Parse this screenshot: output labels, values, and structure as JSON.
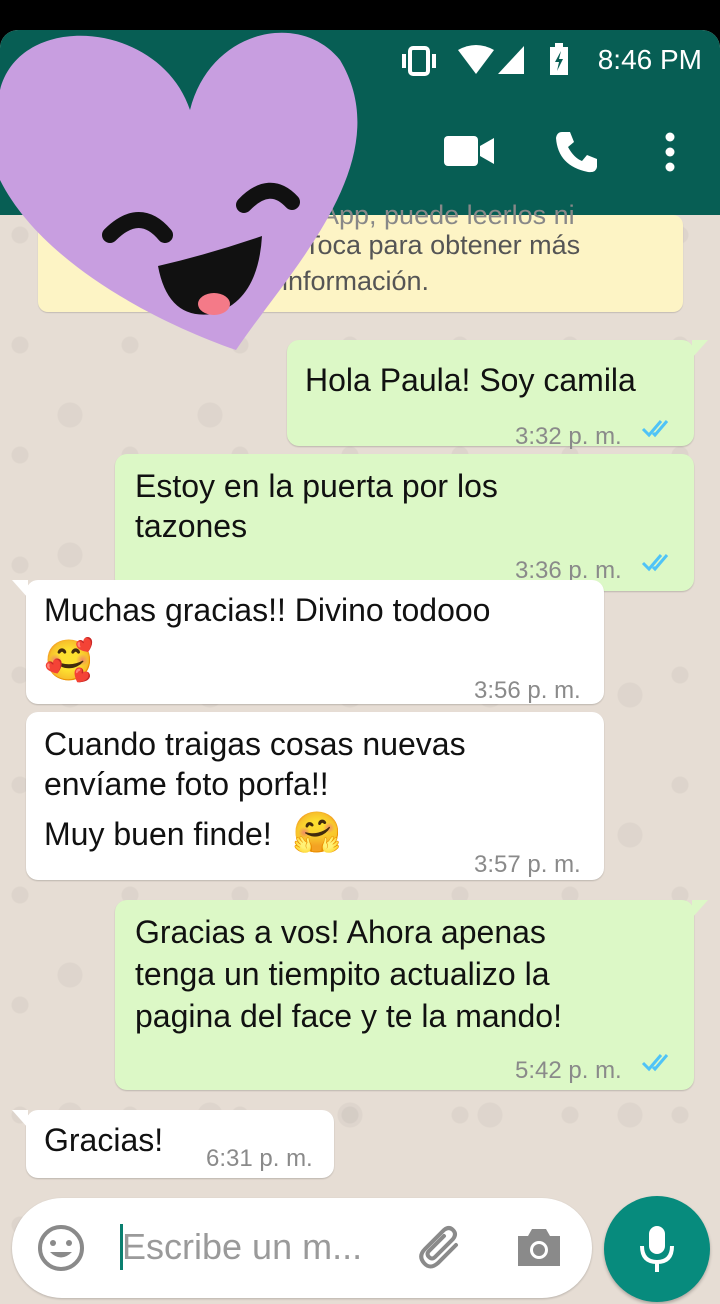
{
  "status": {
    "time": "8:46 PM"
  },
  "notice": {
    "line1": "tsApp, puede leerlos ni",
    "line2": "Toca para obtener más",
    "line3": "información."
  },
  "messages": [
    {
      "dir": "out",
      "text": "Hola Paula! Soy camila",
      "time": "3:32 p. m.",
      "read": true
    },
    {
      "dir": "out",
      "lines": [
        "Estoy en la puerta por los",
        "tazones"
      ],
      "time": "3:36 p. m.",
      "read": true
    },
    {
      "dir": "in",
      "text": "Muchas gracias!! Divino todooo",
      "emoji": "🥰",
      "time": "3:56 p. m."
    },
    {
      "dir": "in",
      "lines": [
        "Cuando traigas cosas nuevas",
        "envíame foto porfa!!",
        "Muy buen finde!"
      ],
      "emoji": "🤗",
      "time": "3:57 p. m."
    },
    {
      "dir": "out",
      "lines": [
        "Gracias a vos! Ahora apenas",
        "tenga un tiempito actualizo la",
        "pagina del face y te la mando!"
      ],
      "time": "5:42 p. m.",
      "read": true
    },
    {
      "dir": "in",
      "text": "Gracias!",
      "time": "6:31 p. m."
    }
  ],
  "composer": {
    "placeholder": "Escribe un m..."
  },
  "colors": {
    "header": "#075e54",
    "outgoing": "#dcf8c6",
    "incoming": "#ffffff",
    "ticks": "#4fc3f7",
    "mic": "#078b7d",
    "sticker": "#c89ee0"
  },
  "icons": [
    "vibrate-icon",
    "wifi-icon",
    "signal-icon",
    "battery-icon",
    "video-call-icon",
    "phone-icon",
    "more-icon",
    "emoji-icon",
    "attach-icon",
    "camera-icon",
    "mic-icon",
    "smiling-heart-sticker"
  ]
}
